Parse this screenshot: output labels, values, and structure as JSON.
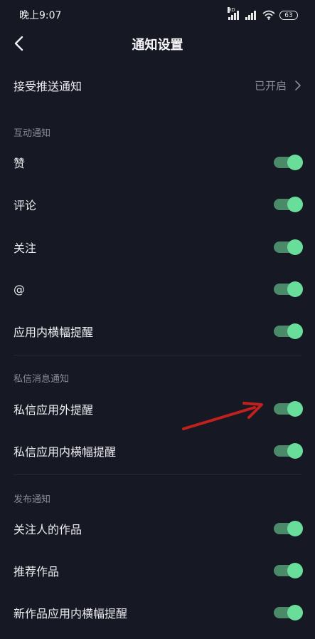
{
  "status_bar": {
    "time": "晚上9:07",
    "hd_label": "HD",
    "battery": "63",
    "icons": [
      "hd-signal-icon",
      "signal-icon",
      "wifi-icon",
      "battery-icon"
    ]
  },
  "header": {
    "title": "通知设置",
    "back_icon": "chevron-left-icon"
  },
  "push": {
    "label": "接受推送通知",
    "value": "已开启",
    "icon": "chevron-right-icon"
  },
  "sections": {
    "interaction": {
      "title": "互动通知",
      "items": [
        {
          "label": "赞",
          "enabled": true
        },
        {
          "label": "评论",
          "enabled": true
        },
        {
          "label": "关注",
          "enabled": true
        },
        {
          "label": "@",
          "enabled": true
        },
        {
          "label": "应用内横幅提醒",
          "enabled": true
        }
      ]
    },
    "private_message": {
      "title": "私信消息通知",
      "items": [
        {
          "label": "私信应用外提醒",
          "enabled": true
        },
        {
          "label": "私信应用内横幅提醒",
          "enabled": true
        }
      ]
    },
    "publish": {
      "title": "发布通知",
      "items": [
        {
          "label": "关注人的作品",
          "enabled": true
        },
        {
          "label": "推荐作品",
          "enabled": true
        },
        {
          "label": "新作品应用内横幅提醒",
          "enabled": true
        }
      ]
    }
  },
  "colors": {
    "background": "#161823",
    "toggle_track_on": "#4a8a69",
    "toggle_knob_on": "#69dd9a",
    "annotation_arrow": "#c0201e"
  }
}
